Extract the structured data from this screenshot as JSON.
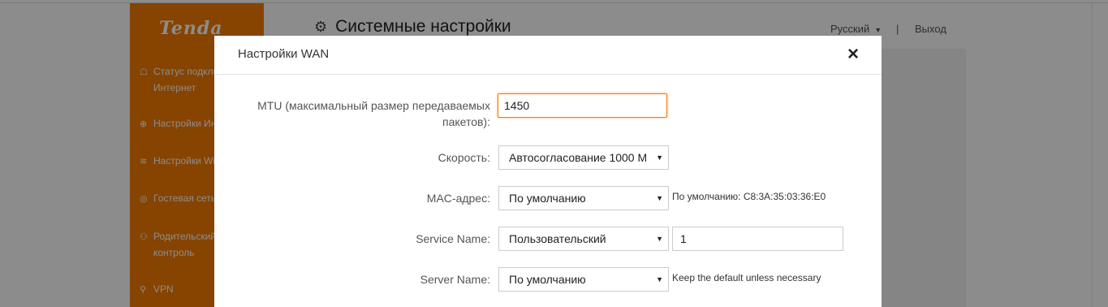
{
  "sidebar": {
    "logo": "Tenda",
    "items": [
      {
        "label": "Статус подключения",
        "label2": "Интернет",
        "icon": "router-icon"
      },
      {
        "label": "Настройки Интернет",
        "icon": "globe-icon"
      },
      {
        "label": "Настройки WiFi",
        "icon": "wifi-icon"
      },
      {
        "label": "Гостевая сеть",
        "icon": "guest-icon"
      },
      {
        "label": "Родительский",
        "label2": "контроль",
        "icon": "parental-icon"
      },
      {
        "label": "VPN",
        "icon": "vpn-icon"
      }
    ]
  },
  "header": {
    "title": "Системные настройки",
    "language": "Русский",
    "separator": "|",
    "logout": "Выход"
  },
  "modal": {
    "title": "Настройки WAN",
    "close": "×",
    "mtu": {
      "label_line1": "MTU (максимальный размер передаваемых",
      "label_line2": "пакетов):",
      "value": "1450"
    },
    "speed": {
      "label": "Скорость:",
      "value": "Автосогласование 1000 M"
    },
    "mac": {
      "label": "MAC-адрес:",
      "value": "По умолчанию",
      "hint": "По умолчанию: C8:3A:35:03:36:E0"
    },
    "service": {
      "label": "Service Name:",
      "value": "Пользовательский",
      "input": "1"
    },
    "server": {
      "label": "Server Name:",
      "value": "По умолчанию",
      "hint": "Keep the default unless necessary"
    }
  },
  "colors": {
    "accent": "#f57c00",
    "overlay": "rgba(0,0,0,0.45)"
  }
}
